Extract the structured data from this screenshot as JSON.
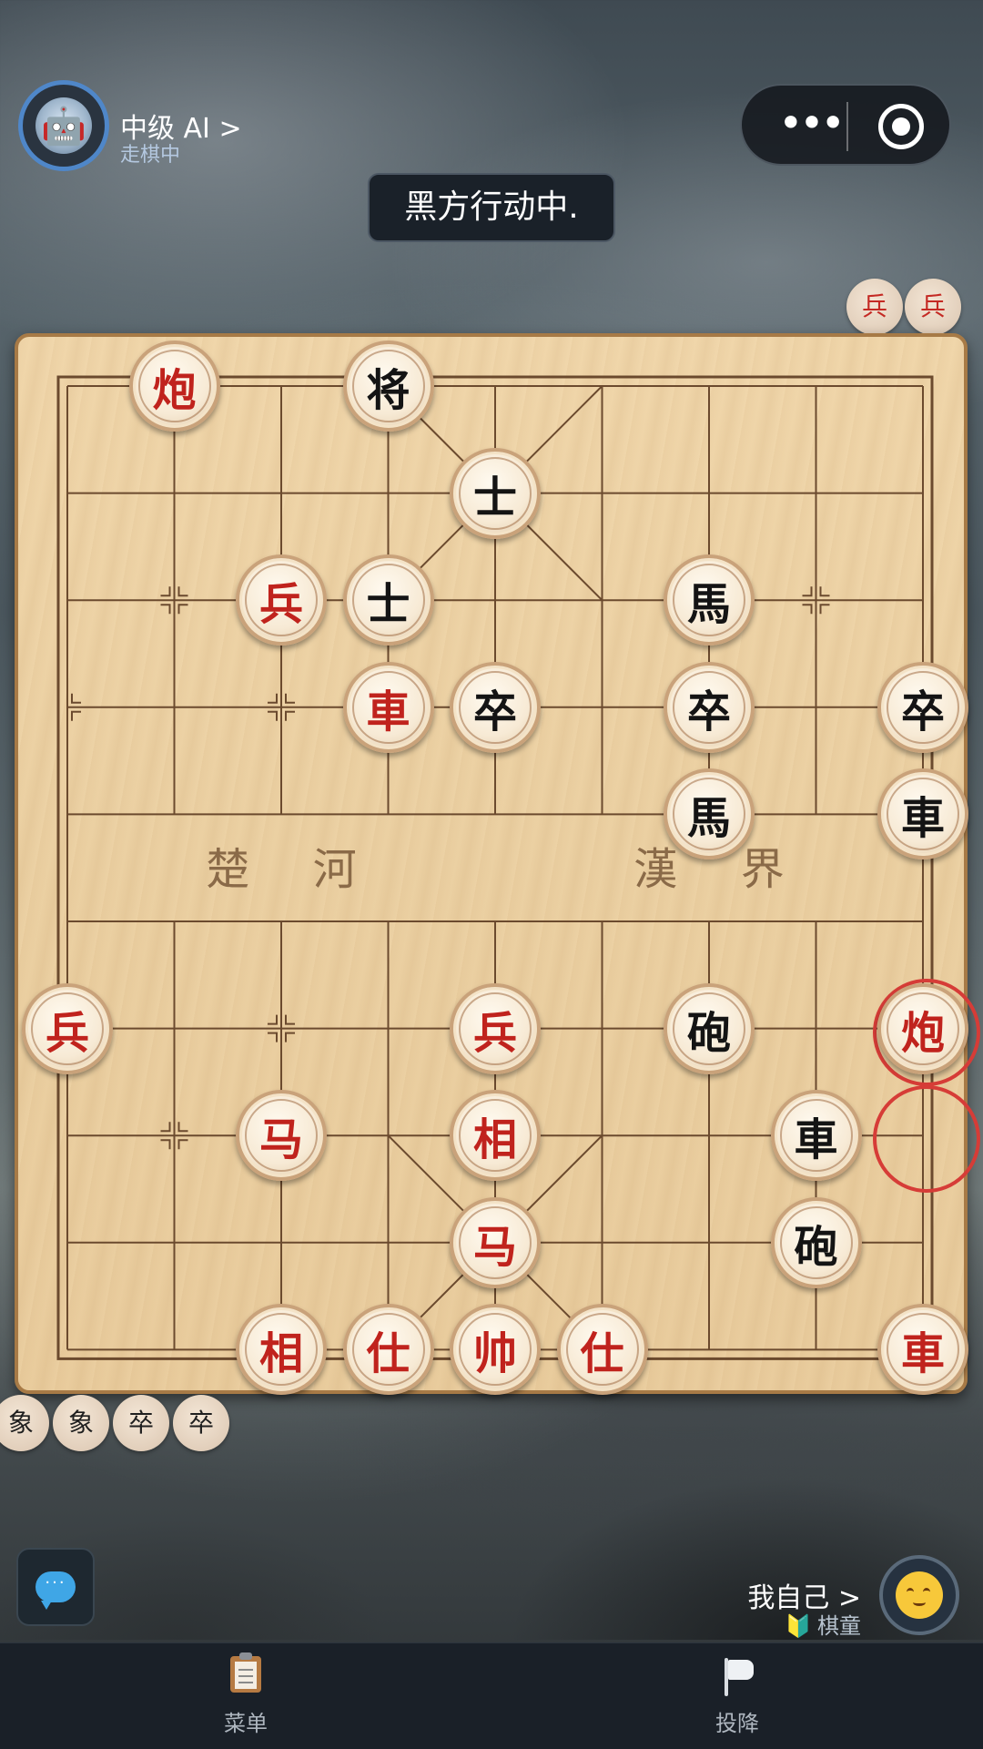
{
  "opponent": {
    "name": "中级 AI >",
    "status": "走棋中",
    "avatar_icon": "robot-avatar-icon"
  },
  "top_capsule": {
    "more_label": "•••",
    "more_icon": "more-dots-icon",
    "close_icon": "target-record-icon"
  },
  "turn_banner": "黑方行动中.",
  "board": {
    "river_left": [
      "楚",
      "河"
    ],
    "river_right": [
      "漢",
      "界"
    ],
    "pieces": [
      {
        "char": "炮",
        "side": "red",
        "col": 1,
        "row": 0
      },
      {
        "char": "将",
        "side": "black",
        "col": 3,
        "row": 0
      },
      {
        "char": "士",
        "side": "black",
        "col": 4,
        "row": 1
      },
      {
        "char": "兵",
        "side": "red",
        "col": 2,
        "row": 2
      },
      {
        "char": "士",
        "side": "black",
        "col": 3,
        "row": 2
      },
      {
        "char": "馬",
        "side": "black",
        "col": 6,
        "row": 2
      },
      {
        "char": "車",
        "side": "red",
        "col": 3,
        "row": 3
      },
      {
        "char": "卒",
        "side": "black",
        "col": 4,
        "row": 3
      },
      {
        "char": "卒",
        "side": "black",
        "col": 6,
        "row": 3
      },
      {
        "char": "卒",
        "side": "black",
        "col": 8,
        "row": 3
      },
      {
        "char": "馬",
        "side": "black",
        "col": 6,
        "row": 4
      },
      {
        "char": "車",
        "side": "black",
        "col": 8,
        "row": 4
      },
      {
        "char": "兵",
        "side": "red",
        "col": 0,
        "row": 6
      },
      {
        "char": "兵",
        "side": "red",
        "col": 4,
        "row": 6
      },
      {
        "char": "砲",
        "side": "black",
        "col": 6,
        "row": 6
      },
      {
        "char": "炮",
        "side": "red",
        "col": 8,
        "row": 6
      },
      {
        "char": "马",
        "side": "red",
        "col": 2,
        "row": 7
      },
      {
        "char": "相",
        "side": "red",
        "col": 4,
        "row": 7
      },
      {
        "char": "車",
        "side": "black",
        "col": 7,
        "row": 7
      },
      {
        "char": "马",
        "side": "red",
        "col": 4,
        "row": 8
      },
      {
        "char": "砲",
        "side": "black",
        "col": 7,
        "row": 8
      },
      {
        "char": "相",
        "side": "red",
        "col": 2,
        "row": 9
      },
      {
        "char": "仕",
        "side": "red",
        "col": 3,
        "row": 9
      },
      {
        "char": "帅",
        "side": "red",
        "col": 4,
        "row": 9
      },
      {
        "char": "仕",
        "side": "red",
        "col": 5,
        "row": 9
      },
      {
        "char": "車",
        "side": "red",
        "col": 8,
        "row": 9
      }
    ],
    "last_move": {
      "from": {
        "col": 8,
        "row": 7
      },
      "to": {
        "col": 8,
        "row": 6
      },
      "color": "#d63c37"
    }
  },
  "captured_top": [
    {
      "char": "兵",
      "side": "red"
    },
    {
      "char": "兵",
      "side": "red"
    }
  ],
  "captured_bottom": [
    {
      "char": "象",
      "side": "black"
    },
    {
      "char": "象",
      "side": "black"
    },
    {
      "char": "卒",
      "side": "black"
    },
    {
      "char": "卒",
      "side": "black"
    }
  ],
  "me": {
    "name": "我自己 >",
    "rank": "棋童",
    "rank_icon": "beginner-leaf-icon",
    "avatar_icon": "smiley-avatar-icon"
  },
  "chat_icon": "chat-bubble-icon",
  "tabs": [
    {
      "label": "菜单",
      "icon": "clipboard-icon"
    },
    {
      "label": "投降",
      "icon": "flag-icon"
    }
  ],
  "colors": {
    "red_piece": "#c0231d",
    "black_piece": "#141414",
    "board_line": "#6b4a2e",
    "accent_blue": "#4f87c9"
  }
}
